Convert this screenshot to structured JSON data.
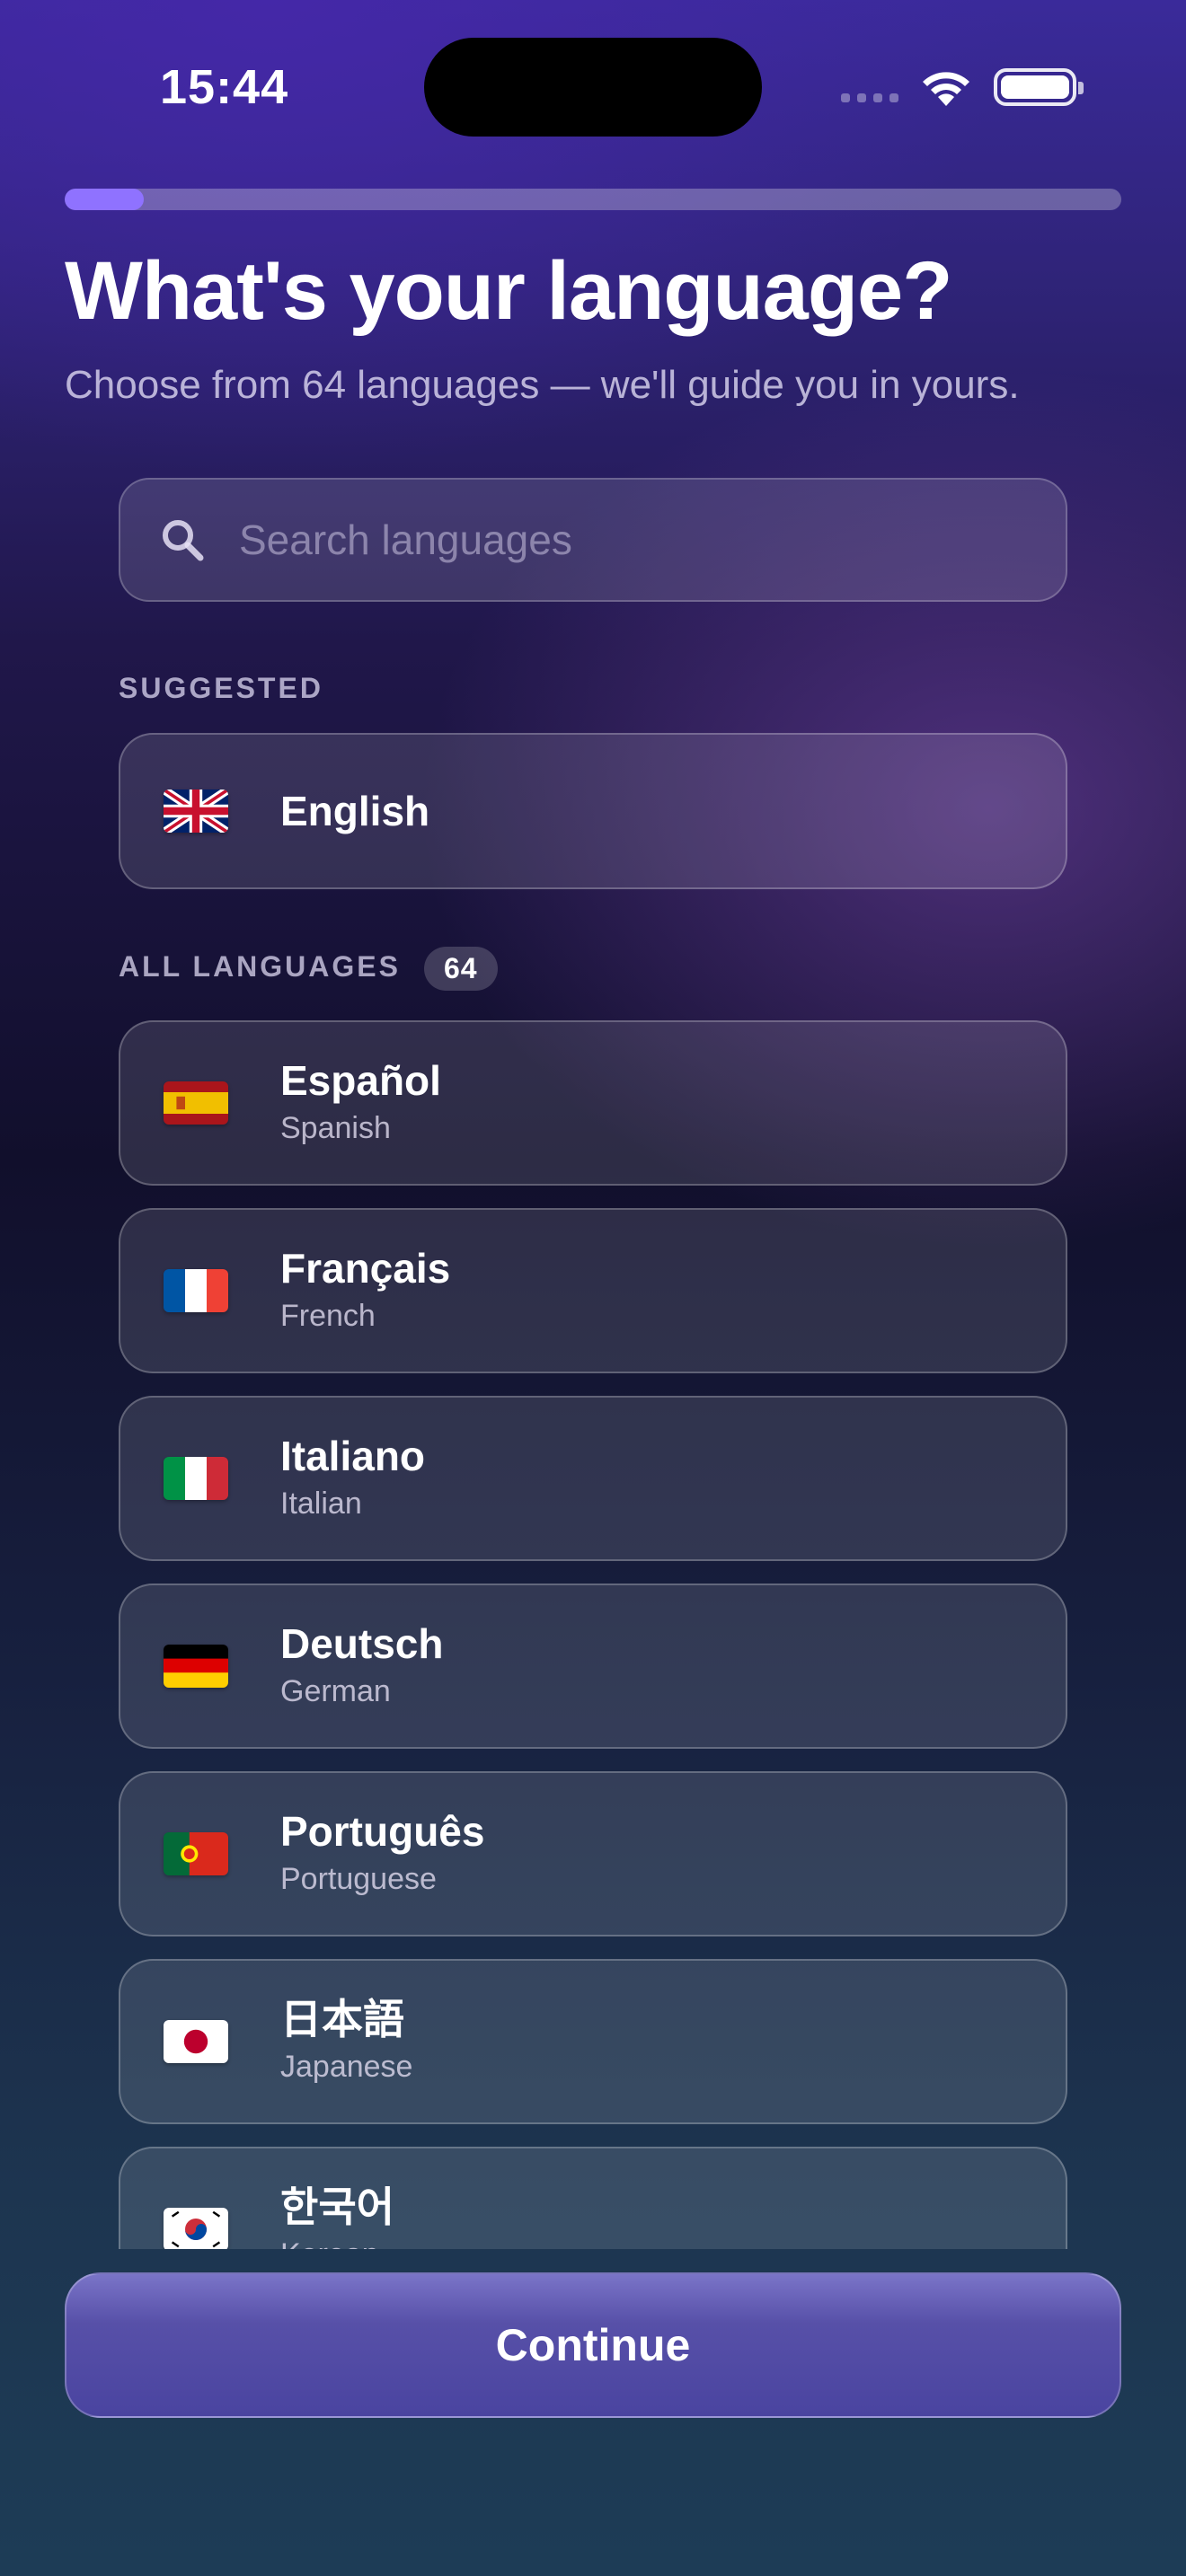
{
  "status_bar": {
    "time": "15:44"
  },
  "progress": {
    "fraction": 0.075
  },
  "header": {
    "title": "What's your language?",
    "subtitle": "Choose from 64 languages — we'll guide you in yours."
  },
  "search": {
    "placeholder": "Search languages",
    "value": ""
  },
  "suggested": {
    "label": "SUGGESTED",
    "items": [
      {
        "name": "English",
        "flag": "uk-flag-icon"
      }
    ]
  },
  "all_languages": {
    "label": "ALL LANGUAGES",
    "count": "64",
    "items": [
      {
        "native": "Español",
        "english": "Spanish",
        "flag": "spain-flag-icon"
      },
      {
        "native": "Français",
        "english": "French",
        "flag": "france-flag-icon"
      },
      {
        "native": "Italiano",
        "english": "Italian",
        "flag": "italy-flag-icon"
      },
      {
        "native": "Deutsch",
        "english": "German",
        "flag": "germany-flag-icon"
      },
      {
        "native": "Português",
        "english": "Portuguese",
        "flag": "portugal-flag-icon"
      },
      {
        "native": "日本語",
        "english": "Japanese",
        "flag": "japan-flag-icon"
      },
      {
        "native": "한국어",
        "english": "Korean",
        "flag": "south-korea-flag-icon"
      }
    ]
  },
  "footer": {
    "continue_label": "Continue"
  },
  "colors": {
    "accent": "#8f72ff",
    "button": "#4a44a0"
  }
}
